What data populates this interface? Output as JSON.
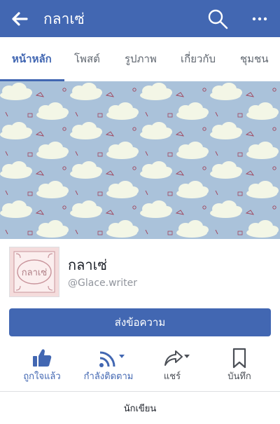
{
  "header": {
    "title": "กลาเซ่"
  },
  "tabs": [
    {
      "label": "หน้าหลัก"
    },
    {
      "label": "โพสต์"
    },
    {
      "label": "รูปภาพ"
    },
    {
      "label": "เกี่ยวกับ"
    },
    {
      "label": "ชุมชน"
    }
  ],
  "profile": {
    "name": "กลาเซ่",
    "handle": "@Glace.writer",
    "avatar_text": "กลาเซ่"
  },
  "message_button": "ส่งข้อความ",
  "actions": [
    {
      "label": "ถูกใจแล้ว",
      "icon": "thumbs-up-icon"
    },
    {
      "label": "กำลังติดตาม",
      "icon": "rss-follow-icon"
    },
    {
      "label": "แชร์",
      "icon": "share-arrow-icon"
    },
    {
      "label": "บันทึก",
      "icon": "bookmark-icon"
    }
  ],
  "category": "นักเขียน",
  "colors": {
    "brand": "#4267b2",
    "cover_sky": "#aac2da"
  }
}
